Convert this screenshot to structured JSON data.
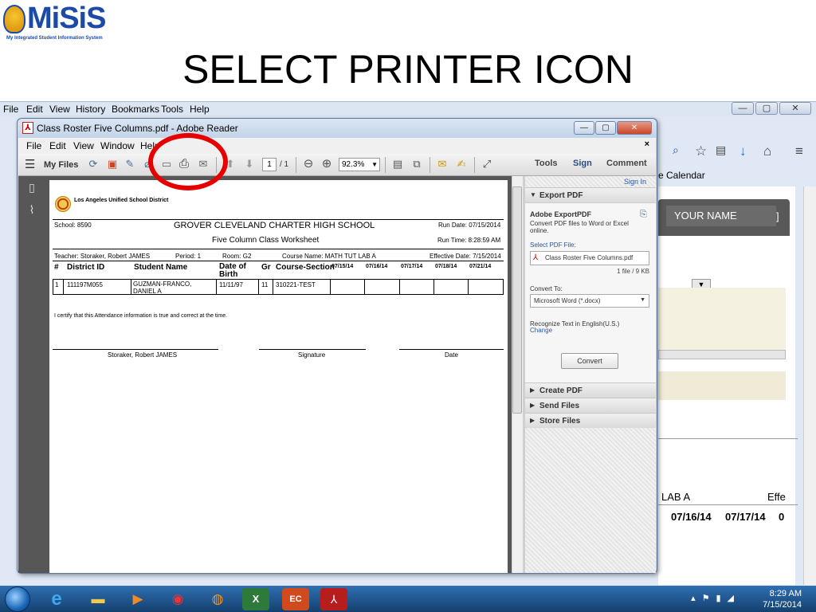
{
  "logo": {
    "word": "MiSiS",
    "subtitle": "My Integrated Student Information System"
  },
  "slide_title": "SELECT PRINTER ICON",
  "browser": {
    "menu": [
      "File",
      "Edit",
      "View",
      "History",
      "Bookmarks",
      "Tools",
      "Help"
    ],
    "calendar_link": "e Calendar",
    "your_name_label": "YOUR NAME",
    "bracket": "]",
    "lab_text": "LAB A",
    "effe_text": "Effe",
    "dates": [
      "07/16/14",
      "07/17/14",
      "0"
    ]
  },
  "reader": {
    "title": "Class Roster Five Columns.pdf - Adobe Reader",
    "menu": [
      "File",
      "Edit",
      "View",
      "Window",
      "Help"
    ],
    "toolbar": {
      "my_files": "My Files",
      "page_current": "1",
      "page_total": "/ 1",
      "zoom": "92.3%",
      "tools_tab": "Tools",
      "sign_tab": "Sign",
      "comment_tab": "Comment"
    },
    "right_pane": {
      "sign_in": "Sign In",
      "export_pdf_header": "Export PDF",
      "adobe_exportpdf": "Adobe ExportPDF",
      "export_desc": "Convert PDF files to Word or Excel online.",
      "select_pdf_file": "Select PDF File:",
      "selected_file": "Class Roster Five Columns.pdf",
      "file_count": "1 file / 9 KB",
      "convert_to_label": "Convert To:",
      "convert_to_value": "Microsoft Word (*.docx)",
      "recognize_text": "Recognize Text in English(U.S.)",
      "change_link": "Change",
      "convert_button": "Convert",
      "create_pdf": "Create PDF",
      "send_files": "Send Files",
      "store_files": "Store Files"
    },
    "document": {
      "district": "Los Angeles Unified School District",
      "school": "School: 8590",
      "school_name": "GROVER CLEVELAND CHARTER HIGH SCHOOL",
      "run_date": "Run Date: 07/15/2014",
      "worksheet": "Five Column Class Worksheet",
      "run_time": "Run Time: 8:28:59 AM",
      "teacher": "Teacher: Storaker, Robert JAMES",
      "period": "Period: 1",
      "room": "Room: G2",
      "course_name": "Course Name: MATH TUT LAB A",
      "effective_date": "Effective Date: 7/15/2014",
      "columns": [
        "#",
        "District ID",
        "Student Name",
        "Date of Birth",
        "Gr",
        "Course-Section",
        "07/15/14",
        "07/16/14",
        "07/17/14",
        "07/18/14",
        "07/21/14"
      ],
      "row": {
        "num": "1",
        "district_id": "111197M055",
        "student_name": "GUZMAN-FRANCO, DANIEL A",
        "dob": "11/11/97",
        "gr": "11",
        "course_section": "310221-TEST"
      },
      "certify": "I certify that this Attendance information is true and correct at the time.",
      "sig_teacher": "Storaker, Robert JAMES",
      "sig_signature": "Signature",
      "sig_date": "Date"
    }
  },
  "taskbar": {
    "time": "8:29 AM",
    "date": "7/15/2014"
  },
  "colors": {
    "annotation_red": "#e60000",
    "logo_blue": "#1b4aa8",
    "taskbar_blue": "#1f5791"
  }
}
